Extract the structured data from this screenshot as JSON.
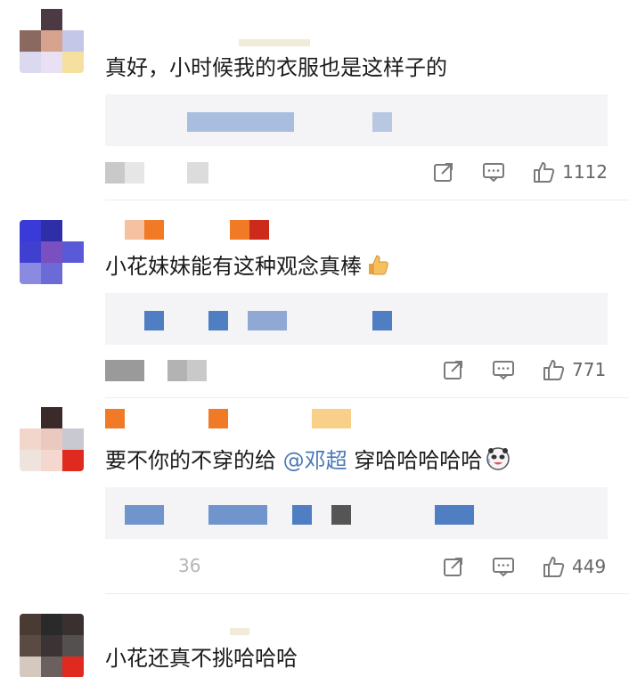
{
  "comments": [
    {
      "text": "真好，小时候我的衣服也是这样子的",
      "likes": "1112",
      "time": ""
    },
    {
      "text": "小花妹妹能有这种观念真棒",
      "emoji": "thumbs-up-emoji",
      "likes": "771",
      "time": ""
    },
    {
      "text_before": "要不你的不穿的给",
      "mention": "@邓超",
      "text_after": "穿哈哈哈哈哈",
      "emoji": "laughing-panda-emoji",
      "likes": "449",
      "time": "36"
    },
    {
      "text": "小花还真不挑哈哈哈"
    }
  ],
  "icons": {
    "share": "share-icon",
    "reply": "comment-icon",
    "like": "thumbs-up-icon"
  },
  "colors": {
    "mention": "#4a78b8",
    "icon": "#7a7a7a",
    "reply_bg": "#f4f4f6"
  }
}
